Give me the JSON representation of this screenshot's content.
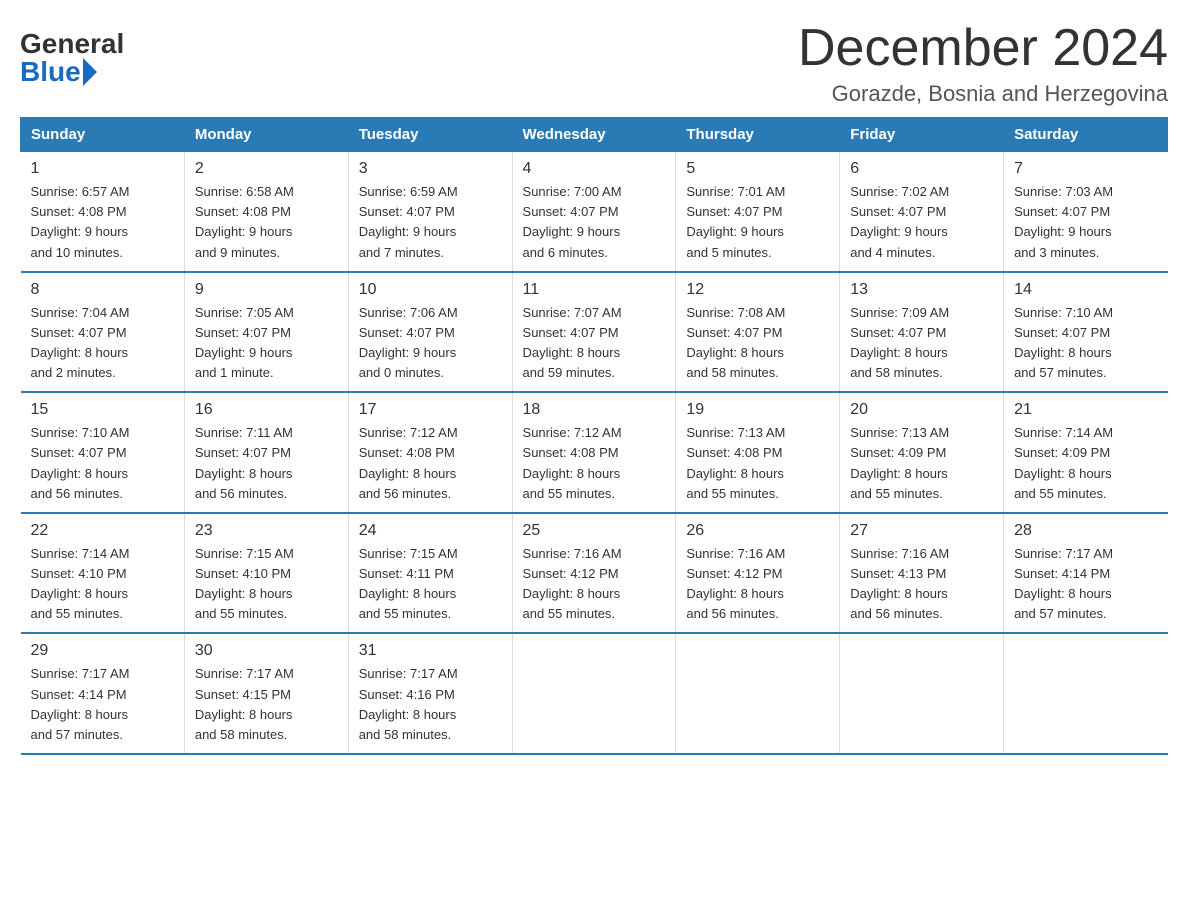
{
  "logo": {
    "general": "General",
    "blue": "Blue"
  },
  "title": "December 2024",
  "location": "Gorazde, Bosnia and Herzegovina",
  "weekdays": [
    "Sunday",
    "Monday",
    "Tuesday",
    "Wednesday",
    "Thursday",
    "Friday",
    "Saturday"
  ],
  "weeks": [
    [
      {
        "day": "1",
        "sunrise": "6:57 AM",
        "sunset": "4:08 PM",
        "daylight": "9 hours and 10 minutes."
      },
      {
        "day": "2",
        "sunrise": "6:58 AM",
        "sunset": "4:08 PM",
        "daylight": "9 hours and 9 minutes."
      },
      {
        "day": "3",
        "sunrise": "6:59 AM",
        "sunset": "4:07 PM",
        "daylight": "9 hours and 7 minutes."
      },
      {
        "day": "4",
        "sunrise": "7:00 AM",
        "sunset": "4:07 PM",
        "daylight": "9 hours and 6 minutes."
      },
      {
        "day": "5",
        "sunrise": "7:01 AM",
        "sunset": "4:07 PM",
        "daylight": "9 hours and 5 minutes."
      },
      {
        "day": "6",
        "sunrise": "7:02 AM",
        "sunset": "4:07 PM",
        "daylight": "9 hours and 4 minutes."
      },
      {
        "day": "7",
        "sunrise": "7:03 AM",
        "sunset": "4:07 PM",
        "daylight": "9 hours and 3 minutes."
      }
    ],
    [
      {
        "day": "8",
        "sunrise": "7:04 AM",
        "sunset": "4:07 PM",
        "daylight": "8 hours and 2 minutes."
      },
      {
        "day": "9",
        "sunrise": "7:05 AM",
        "sunset": "4:07 PM",
        "daylight": "9 hours and 1 minute."
      },
      {
        "day": "10",
        "sunrise": "7:06 AM",
        "sunset": "4:07 PM",
        "daylight": "9 hours and 0 minutes."
      },
      {
        "day": "11",
        "sunrise": "7:07 AM",
        "sunset": "4:07 PM",
        "daylight": "8 hours and 59 minutes."
      },
      {
        "day": "12",
        "sunrise": "7:08 AM",
        "sunset": "4:07 PM",
        "daylight": "8 hours and 58 minutes."
      },
      {
        "day": "13",
        "sunrise": "7:09 AM",
        "sunset": "4:07 PM",
        "daylight": "8 hours and 58 minutes."
      },
      {
        "day": "14",
        "sunrise": "7:10 AM",
        "sunset": "4:07 PM",
        "daylight": "8 hours and 57 minutes."
      }
    ],
    [
      {
        "day": "15",
        "sunrise": "7:10 AM",
        "sunset": "4:07 PM",
        "daylight": "8 hours and 56 minutes."
      },
      {
        "day": "16",
        "sunrise": "7:11 AM",
        "sunset": "4:07 PM",
        "daylight": "8 hours and 56 minutes."
      },
      {
        "day": "17",
        "sunrise": "7:12 AM",
        "sunset": "4:08 PM",
        "daylight": "8 hours and 56 minutes."
      },
      {
        "day": "18",
        "sunrise": "7:12 AM",
        "sunset": "4:08 PM",
        "daylight": "8 hours and 55 minutes."
      },
      {
        "day": "19",
        "sunrise": "7:13 AM",
        "sunset": "4:08 PM",
        "daylight": "8 hours and 55 minutes."
      },
      {
        "day": "20",
        "sunrise": "7:13 AM",
        "sunset": "4:09 PM",
        "daylight": "8 hours and 55 minutes."
      },
      {
        "day": "21",
        "sunrise": "7:14 AM",
        "sunset": "4:09 PM",
        "daylight": "8 hours and 55 minutes."
      }
    ],
    [
      {
        "day": "22",
        "sunrise": "7:14 AM",
        "sunset": "4:10 PM",
        "daylight": "8 hours and 55 minutes."
      },
      {
        "day": "23",
        "sunrise": "7:15 AM",
        "sunset": "4:10 PM",
        "daylight": "8 hours and 55 minutes."
      },
      {
        "day": "24",
        "sunrise": "7:15 AM",
        "sunset": "4:11 PM",
        "daylight": "8 hours and 55 minutes."
      },
      {
        "day": "25",
        "sunrise": "7:16 AM",
        "sunset": "4:12 PM",
        "daylight": "8 hours and 55 minutes."
      },
      {
        "day": "26",
        "sunrise": "7:16 AM",
        "sunset": "4:12 PM",
        "daylight": "8 hours and 56 minutes."
      },
      {
        "day": "27",
        "sunrise": "7:16 AM",
        "sunset": "4:13 PM",
        "daylight": "8 hours and 56 minutes."
      },
      {
        "day": "28",
        "sunrise": "7:17 AM",
        "sunset": "4:14 PM",
        "daylight": "8 hours and 57 minutes."
      }
    ],
    [
      {
        "day": "29",
        "sunrise": "7:17 AM",
        "sunset": "4:14 PM",
        "daylight": "8 hours and 57 minutes."
      },
      {
        "day": "30",
        "sunrise": "7:17 AM",
        "sunset": "4:15 PM",
        "daylight": "8 hours and 58 minutes."
      },
      {
        "day": "31",
        "sunrise": "7:17 AM",
        "sunset": "4:16 PM",
        "daylight": "8 hours and 58 minutes."
      },
      null,
      null,
      null,
      null
    ]
  ],
  "labels": {
    "sunrise": "Sunrise:",
    "sunset": "Sunset:",
    "daylight": "Daylight:"
  }
}
